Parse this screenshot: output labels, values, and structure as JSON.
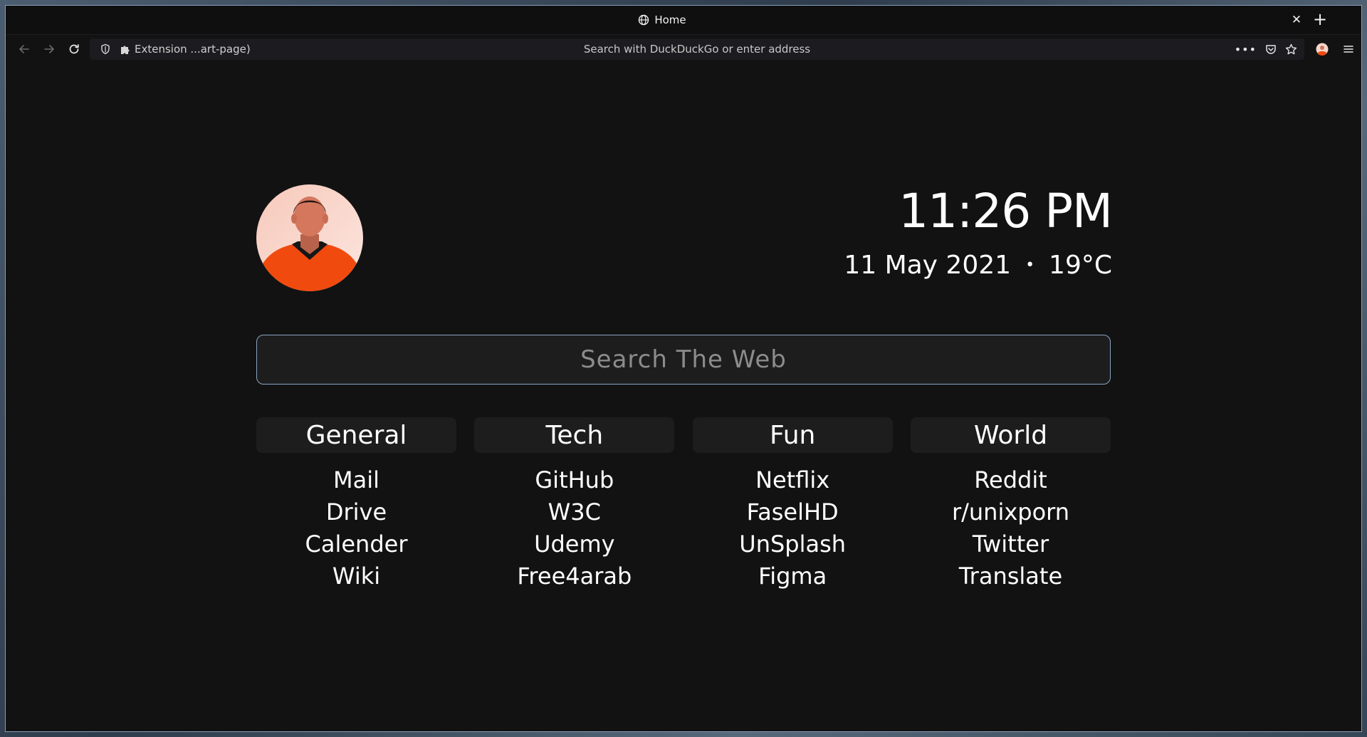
{
  "browser": {
    "tab_title": "Home",
    "url_extension_label": "Extension ...art-page)",
    "url_placeholder": "Search with DuckDuckGo or enter address"
  },
  "header": {
    "time": "11:26 PM",
    "date": "11 May 2021",
    "separator": "•",
    "temperature": "19°C"
  },
  "search": {
    "placeholder": "Search The Web"
  },
  "categories": [
    {
      "title": "General",
      "links": [
        "Mail",
        "Drive",
        "Calender",
        "Wiki"
      ]
    },
    {
      "title": "Tech",
      "links": [
        "GitHub",
        "W3C",
        "Udemy",
        "Free4arab"
      ]
    },
    {
      "title": "Fun",
      "links": [
        "Netflix",
        "FaselHD",
        "UnSplash",
        "Figma"
      ]
    },
    {
      "title": "World",
      "links": [
        "Reddit",
        "r/unixporn",
        "Twitter",
        "Translate"
      ]
    }
  ],
  "colors": {
    "background": "#121212",
    "panel": "#1d1d1d",
    "search_border": "#8aa6c2",
    "avatar_shirt": "#f04a0f",
    "text": "#ffffff"
  }
}
